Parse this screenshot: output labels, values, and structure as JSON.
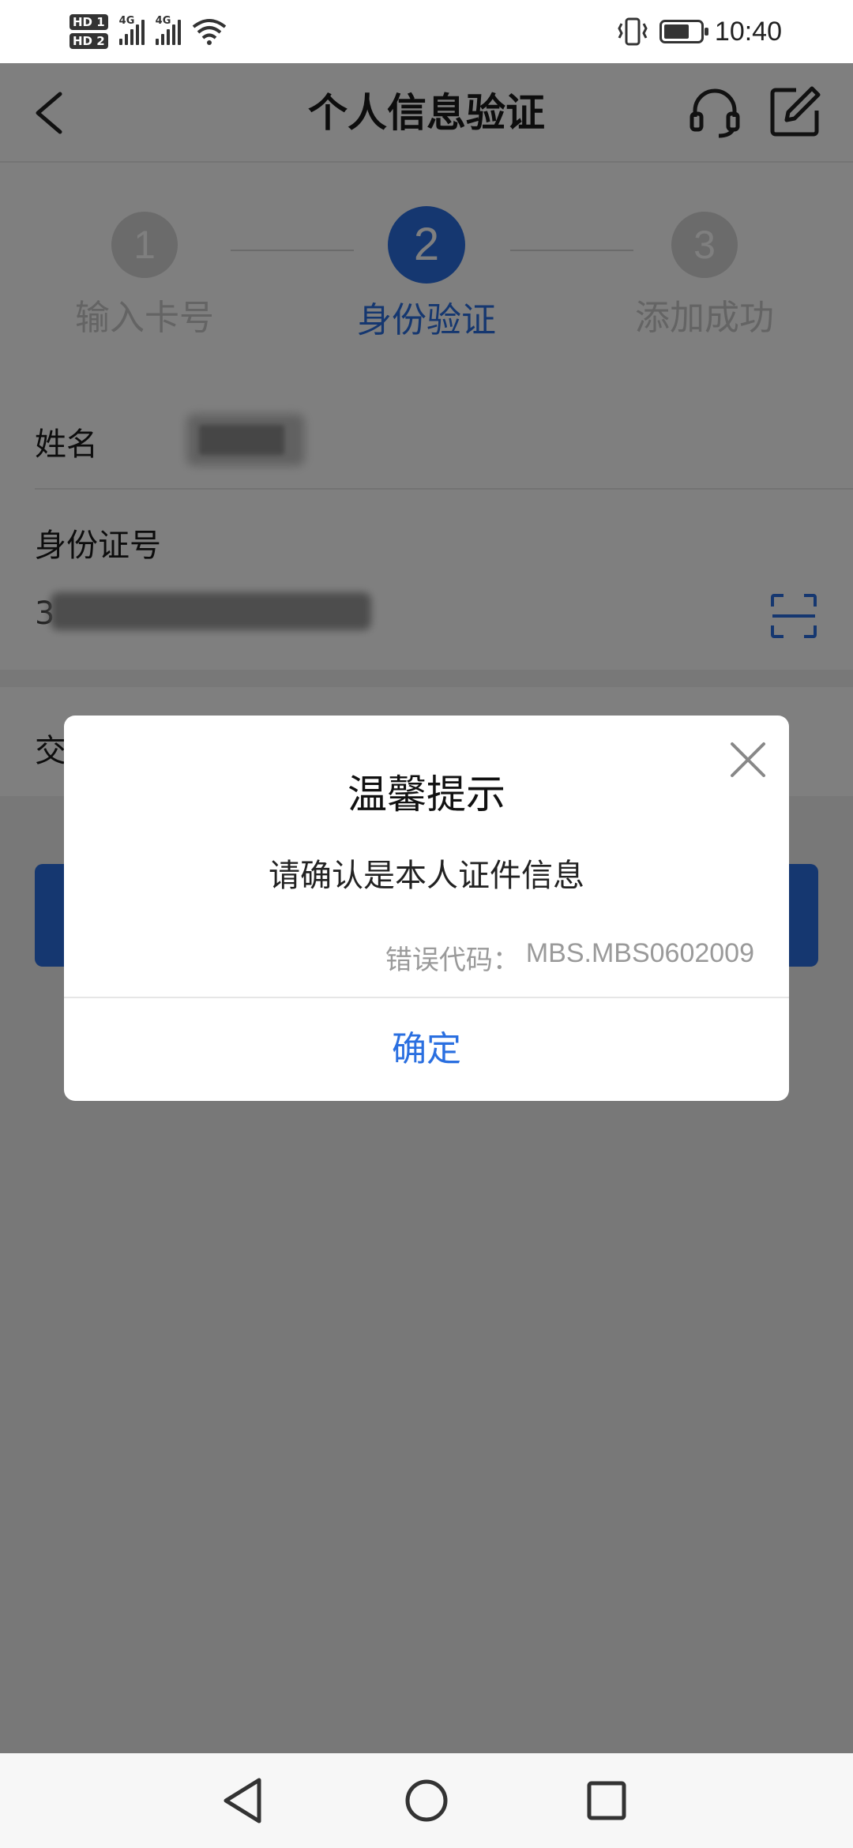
{
  "status_bar": {
    "time": "10:40",
    "sim1_badge": "HD 1",
    "sim2_badge": "HD 2",
    "network1": "4G",
    "network2": "4G",
    "battery_level": 0.7
  },
  "nav": {
    "title": "个人信息验证",
    "back_icon": "chevron-left-icon",
    "service_icon": "headset-icon",
    "edit_icon": "edit-icon"
  },
  "stepper": {
    "steps": [
      {
        "number": "1",
        "label": "输入卡号"
      },
      {
        "number": "2",
        "label": "身份验证"
      },
      {
        "number": "3",
        "label": "添加成功"
      }
    ],
    "active_index": 1
  },
  "form": {
    "name_label": "姓名",
    "id_label": "身份证号",
    "id_value_visible": "3",
    "third_label_partial": "交",
    "scan_icon": "scan-icon"
  },
  "dialog": {
    "title": "温馨提示",
    "message": "请确认是本人证件信息",
    "error_code_label": "错误代码：",
    "error_code": "MBS.MBS0602009",
    "ok_label": "确定",
    "close_icon": "close-icon"
  },
  "system_nav": {
    "back": "triangle-back-icon",
    "home": "circle-home-icon",
    "recents": "square-recents-icon"
  },
  "colors": {
    "accent": "#2a6fe0",
    "overlay": "rgba(0,0,0,0.5)"
  }
}
